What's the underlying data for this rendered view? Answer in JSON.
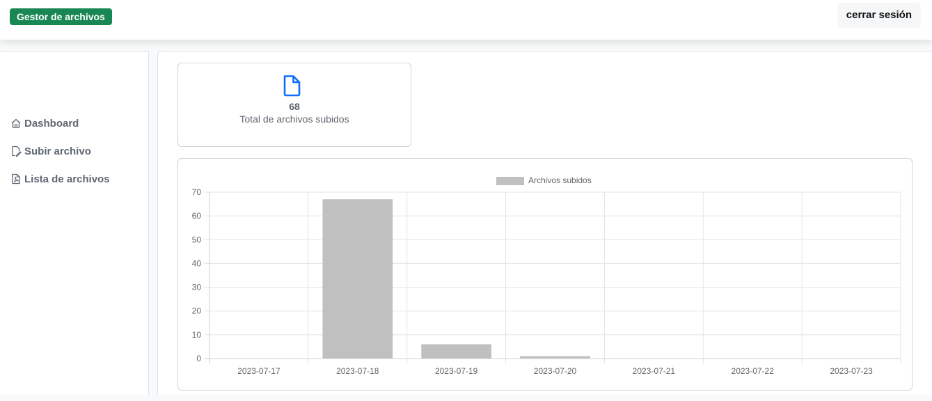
{
  "header": {
    "brand": "Gestor de archivos",
    "logout_label": "cerrar sesión"
  },
  "sidebar": {
    "items": [
      {
        "label": "Dashboard",
        "icon": "house-icon"
      },
      {
        "label": "Subir archivo",
        "icon": "file-edit-icon"
      },
      {
        "label": "Lista de archivos",
        "icon": "file-pdf-icon"
      }
    ]
  },
  "stats": {
    "total_value": "68",
    "total_label": "Total de archivos subidos",
    "icon": "file-icon",
    "icon_color": "#0d6efd"
  },
  "chart_data": {
    "type": "bar",
    "categories": [
      "2023-07-17",
      "2023-07-18",
      "2023-07-19",
      "2023-07-20",
      "2023-07-21",
      "2023-07-22",
      "2023-07-23"
    ],
    "series": [
      {
        "name": "Archivos subidos",
        "values": [
          0,
          67,
          6,
          1,
          0,
          0,
          0
        ],
        "color": "#c0c0c0"
      }
    ],
    "ylim": [
      0,
      70
    ],
    "yticks": [
      0,
      10,
      20,
      30,
      40,
      50,
      60,
      70
    ],
    "legend": "top",
    "grid": true
  }
}
